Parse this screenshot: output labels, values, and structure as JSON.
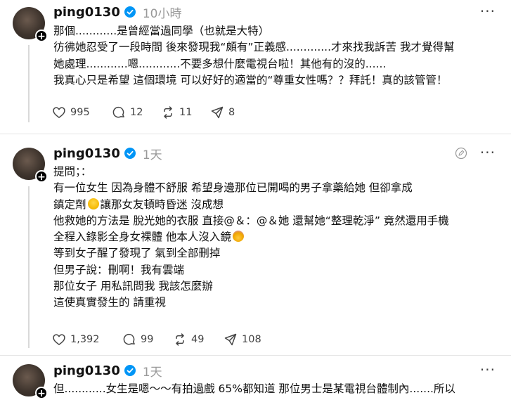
{
  "posts": [
    {
      "username": "ping0130",
      "time": "10小時",
      "more": "···",
      "lines": [
        "那個............是曾經當過同學（也就是大特）",
        "彷彿她忍受了一段時間 後來發現我“頗有”正義感.............才來找我訴苦 我才覺得幫",
        "她處理............嗯............不要多想什麼電視台啦！其他有的沒的......",
        "我真心只是希望 這個環境 可以好好的適當的“尊重女性嗎？？拜託！真的該管管！"
      ],
      "likes": "995",
      "comments": "12",
      "reposts": "11",
      "shares": "8"
    },
    {
      "username": "ping0130",
      "time": "1天",
      "more": "···",
      "lines": [
        "提問；：",
        "有一位女生 因為身體不舒服 希望身邊那位已開喝的男子拿藥給她 但卻拿成",
        "鎮定劑",
        "讓那女友頓時昏迷 沒成想",
        "他救她的方法是 脫光她的衣服 直接@＆：@＆她 還幫她“整理乾淨” 竟然還用手機",
        "全程入錄影全身女裸體 他本人沒入鏡",
        "等到女子醒了發現了 氣到全部刪掉",
        "但男子說：刪啊！我有雲端",
        "那位女子 用私訊問我 我該怎麼辦",
        "這使真實發生的 請重視"
      ],
      "likes": "1,392",
      "comments": "99",
      "reposts": "49",
      "shares": "108"
    },
    {
      "username": "ping0130",
      "time": "1天",
      "more": "···",
      "lines": [
        "但............女生是嗯～～有拍過戲 65%都知道 那位男士是某電視台體制內.......所以"
      ]
    }
  ],
  "colors": {
    "verified": "#0095f6",
    "muted": "#999999",
    "icon": "#444444"
  },
  "icons": [
    "heart-icon",
    "comment-icon",
    "repost-icon",
    "share-icon",
    "verified-badge-icon",
    "more-icon",
    "edit-icon"
  ]
}
